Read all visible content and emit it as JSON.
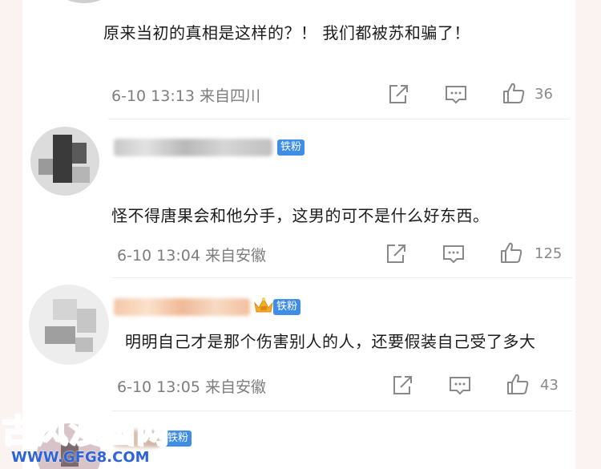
{
  "comments": [
    {
      "text": "原来当初的真相是这样的？！ 我们都被苏和骗了！",
      "time": "6-10 13:13",
      "location": "来自四川",
      "likes": "36"
    },
    {
      "badge": "铁粉",
      "text": "怪不得唐果会和他分手，这男的可不是什么好东西。",
      "time": "6-10 13:04",
      "location": "来自安徽",
      "likes": "125"
    },
    {
      "badge": "铁粉",
      "text": "明明自己才是那个伤害别人的人，还要假装自己受了多大",
      "time": "6-10 13:05",
      "location": "来自安徽",
      "likes": "43"
    },
    {
      "badge": "铁粉"
    }
  ],
  "watermark": {
    "title": "古风漫画网",
    "url": "WWW.GFG8.COM"
  },
  "icons": {
    "share": "share-icon",
    "comment": "comment-icon",
    "like": "thumbs-up-icon",
    "crown": "crown-icon"
  },
  "colors": {
    "badge": "#3e8de6",
    "watermark_title": "#c33aa6",
    "watermark_url": "#2f64d8"
  }
}
